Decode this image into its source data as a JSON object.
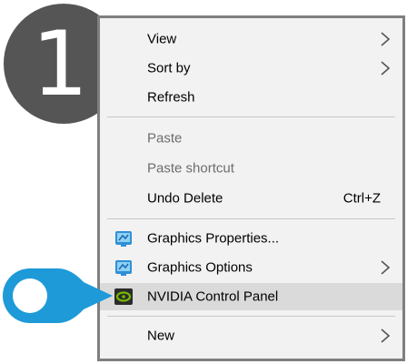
{
  "step_badge": {
    "number": "1",
    "color": "#555555"
  },
  "pointer": {
    "color": "#1e9ad8",
    "icon": "location-pin-pointer-icon"
  },
  "context_menu": {
    "items": [
      {
        "label": "View",
        "submenu": true
      },
      {
        "label": "Sort by",
        "submenu": true
      },
      {
        "label": "Refresh"
      },
      {
        "label": "Paste",
        "disabled": true
      },
      {
        "label": "Paste shortcut",
        "disabled": true
      },
      {
        "label": "Undo Delete",
        "shortcut": "Ctrl+Z"
      },
      {
        "label": "Graphics Properties...",
        "icon": "intel-graphics-icon"
      },
      {
        "label": "Graphics Options",
        "icon": "intel-graphics-icon",
        "submenu": true
      },
      {
        "label": "NVIDIA Control Panel",
        "icon": "nvidia-logo-icon",
        "highlighted": true
      },
      {
        "label": "New",
        "submenu": true
      }
    ]
  }
}
